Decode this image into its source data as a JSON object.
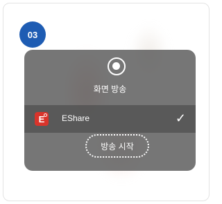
{
  "step": {
    "number": "03"
  },
  "panel": {
    "title": "화면 방송",
    "app": {
      "icon_letter": "E",
      "name": "EShare",
      "selected_mark": "✓"
    },
    "start_button_label": "방송 시작"
  },
  "colors": {
    "badge": "#1e5cb3",
    "app_icon": "#d9342b",
    "panel": "#5f5f5f"
  },
  "icons": [
    "screen-record-icon",
    "eshare-app-icon",
    "checkmark-icon"
  ]
}
